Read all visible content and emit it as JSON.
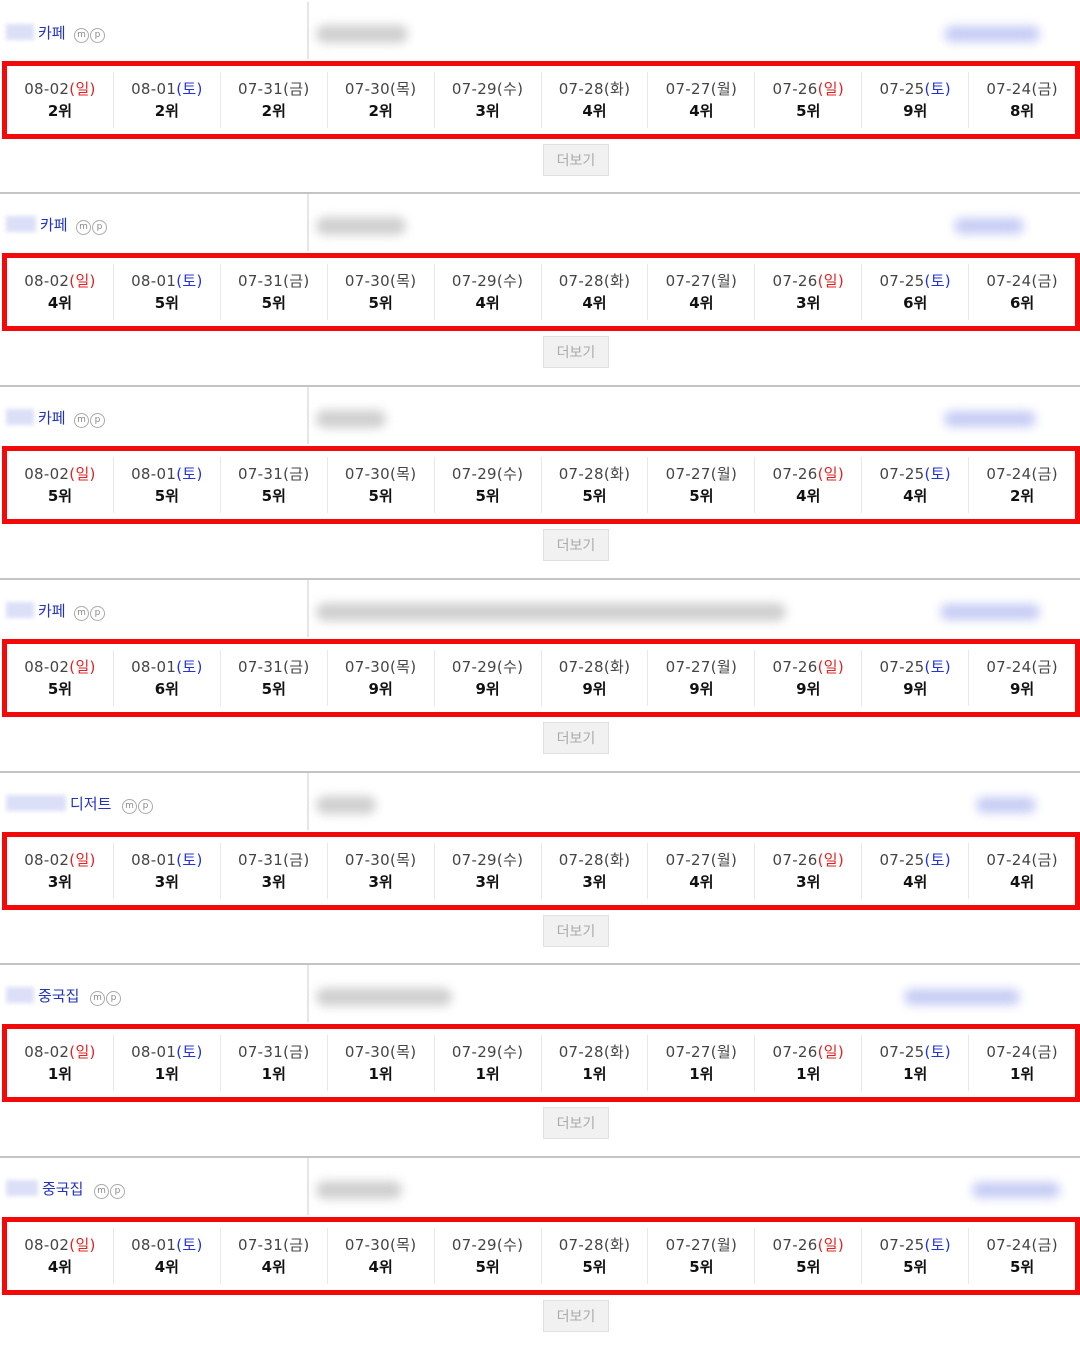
{
  "more_label": "더보기",
  "mp_letters": [
    "m",
    "p"
  ],
  "blocks": [
    {
      "category": "카페",
      "dates": [
        [
          "08-02",
          "일"
        ],
        [
          "08-01",
          "토"
        ],
        [
          "07-31",
          "금"
        ],
        [
          "07-30",
          "목"
        ],
        [
          "07-29",
          "수"
        ],
        [
          "07-28",
          "화"
        ],
        [
          "07-27",
          "월"
        ],
        [
          "07-26",
          "일"
        ],
        [
          "07-25",
          "토"
        ],
        [
          "07-24",
          "금"
        ]
      ],
      "ranks": [
        "2위",
        "2위",
        "2위",
        "2위",
        "3위",
        "4위",
        "4위",
        "5위",
        "9위",
        "8위"
      ]
    },
    {
      "category": "카페",
      "dates": [
        [
          "08-02",
          "일"
        ],
        [
          "08-01",
          "토"
        ],
        [
          "07-31",
          "금"
        ],
        [
          "07-30",
          "목"
        ],
        [
          "07-29",
          "수"
        ],
        [
          "07-28",
          "화"
        ],
        [
          "07-27",
          "월"
        ],
        [
          "07-26",
          "일"
        ],
        [
          "07-25",
          "토"
        ],
        [
          "07-24",
          "금"
        ]
      ],
      "ranks": [
        "4위",
        "5위",
        "5위",
        "5위",
        "4위",
        "4위",
        "4위",
        "3위",
        "6위",
        "6위"
      ]
    },
    {
      "category": "카페",
      "dates": [
        [
          "08-02",
          "일"
        ],
        [
          "08-01",
          "토"
        ],
        [
          "07-31",
          "금"
        ],
        [
          "07-30",
          "목"
        ],
        [
          "07-29",
          "수"
        ],
        [
          "07-28",
          "화"
        ],
        [
          "07-27",
          "월"
        ],
        [
          "07-26",
          "일"
        ],
        [
          "07-25",
          "토"
        ],
        [
          "07-24",
          "금"
        ]
      ],
      "ranks": [
        "5위",
        "5위",
        "5위",
        "5위",
        "5위",
        "5위",
        "5위",
        "4위",
        "4위",
        "2위"
      ]
    },
    {
      "category": "카페",
      "dates": [
        [
          "08-02",
          "일"
        ],
        [
          "08-01",
          "토"
        ],
        [
          "07-31",
          "금"
        ],
        [
          "07-30",
          "목"
        ],
        [
          "07-29",
          "수"
        ],
        [
          "07-28",
          "화"
        ],
        [
          "07-27",
          "월"
        ],
        [
          "07-26",
          "일"
        ],
        [
          "07-25",
          "토"
        ],
        [
          "07-24",
          "금"
        ]
      ],
      "ranks": [
        "5위",
        "6위",
        "5위",
        "9위",
        "9위",
        "9위",
        "9위",
        "9위",
        "9위",
        "9위"
      ]
    },
    {
      "category": "디저트",
      "dates": [
        [
          "08-02",
          "일"
        ],
        [
          "08-01",
          "토"
        ],
        [
          "07-31",
          "금"
        ],
        [
          "07-30",
          "목"
        ],
        [
          "07-29",
          "수"
        ],
        [
          "07-28",
          "화"
        ],
        [
          "07-27",
          "월"
        ],
        [
          "07-26",
          "일"
        ],
        [
          "07-25",
          "토"
        ],
        [
          "07-24",
          "금"
        ]
      ],
      "ranks": [
        "3위",
        "3위",
        "3위",
        "3위",
        "3위",
        "3위",
        "4위",
        "3위",
        "4위",
        "4위"
      ]
    },
    {
      "category": "중국집",
      "dates": [
        [
          "08-02",
          "일"
        ],
        [
          "08-01",
          "토"
        ],
        [
          "07-31",
          "금"
        ],
        [
          "07-30",
          "목"
        ],
        [
          "07-29",
          "수"
        ],
        [
          "07-28",
          "화"
        ],
        [
          "07-27",
          "월"
        ],
        [
          "07-26",
          "일"
        ],
        [
          "07-25",
          "토"
        ],
        [
          "07-24",
          "금"
        ]
      ],
      "ranks": [
        "1위",
        "1위",
        "1위",
        "1위",
        "1위",
        "1위",
        "1위",
        "1위",
        "1위",
        "1위"
      ]
    },
    {
      "category": "중국집",
      "dates": [
        [
          "08-02",
          "일"
        ],
        [
          "08-01",
          "토"
        ],
        [
          "07-31",
          "금"
        ],
        [
          "07-30",
          "목"
        ],
        [
          "07-29",
          "수"
        ],
        [
          "07-28",
          "화"
        ],
        [
          "07-27",
          "월"
        ],
        [
          "07-26",
          "일"
        ],
        [
          "07-25",
          "토"
        ],
        [
          "07-24",
          "금"
        ]
      ],
      "ranks": [
        "4위",
        "4위",
        "4위",
        "4위",
        "5위",
        "5위",
        "5위",
        "5위",
        "5위",
        "5위"
      ]
    }
  ],
  "colors": {
    "highlight_border": "#f20a0a",
    "sunday": "#e52222",
    "saturday": "#2233dd",
    "category_link": "#2233bb"
  }
}
